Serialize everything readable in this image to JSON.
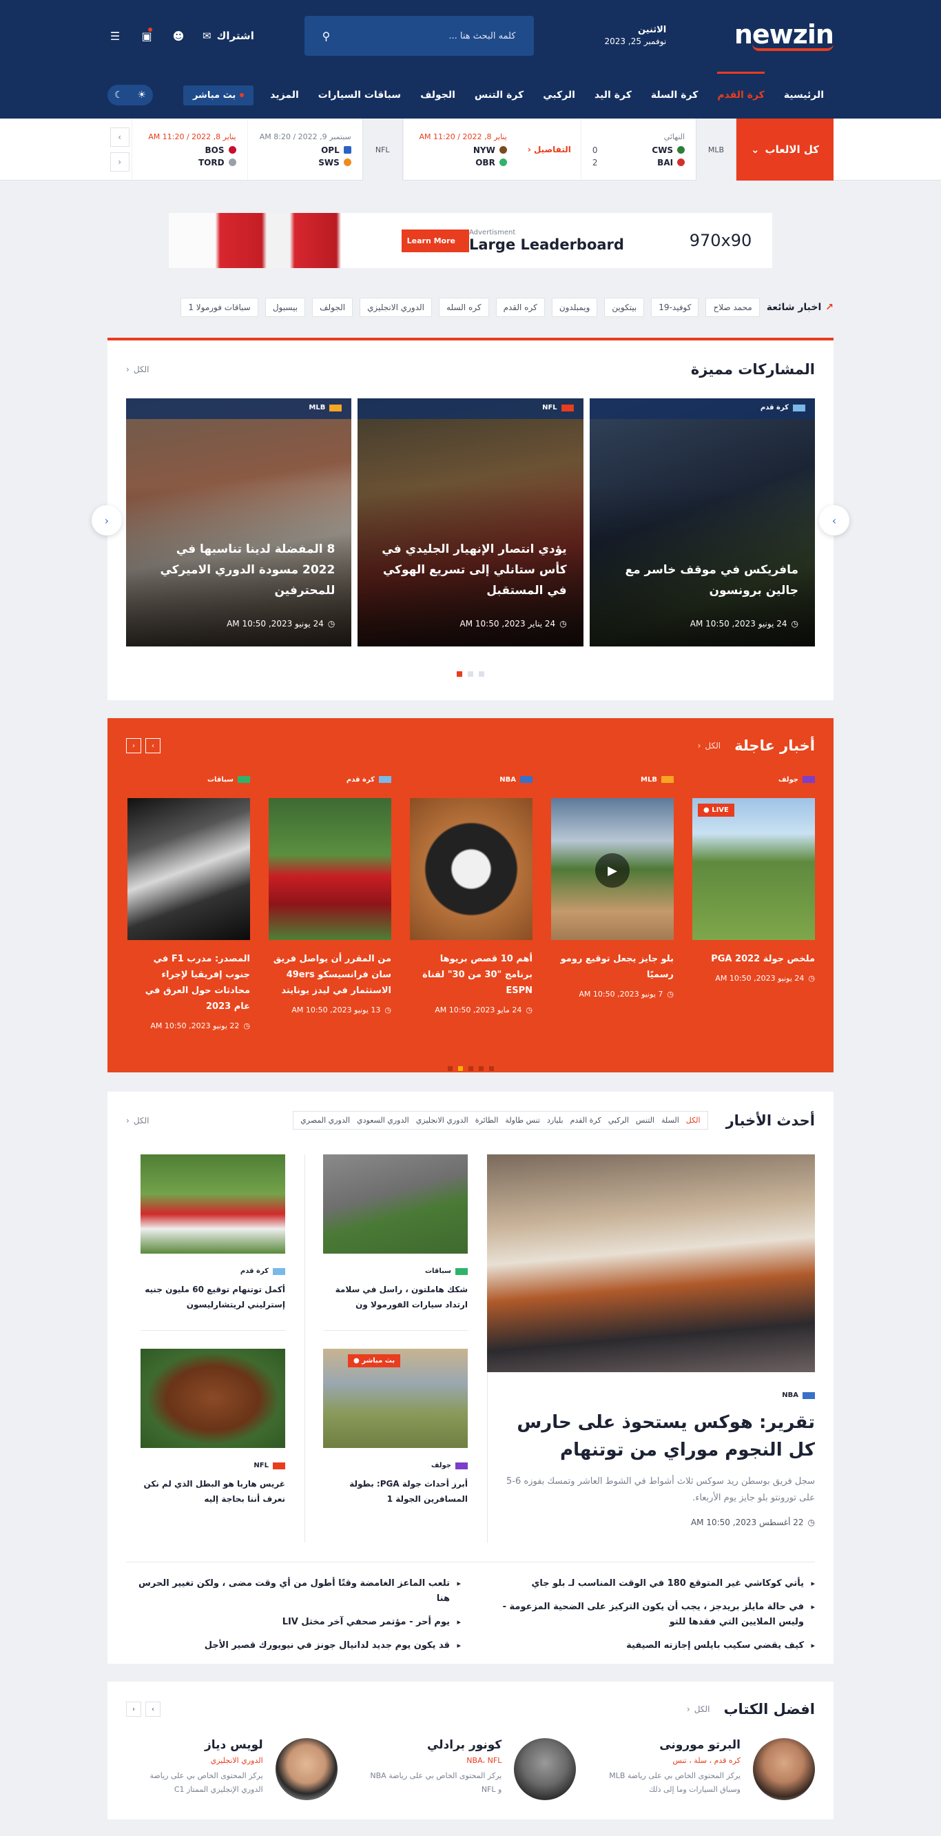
{
  "header": {
    "logo": "newzin",
    "day": "الاثنين",
    "date": "نوفمبر 25, 2023",
    "search_placeholder": "كلمه البحث هنا ...",
    "subscribe": "اشتراك"
  },
  "nav": {
    "items": [
      "الرئيسية",
      "كرة القدم",
      "كرة السلة",
      "كرة اليد",
      "الركبي",
      "كرة التنس",
      "الجولف",
      "سباقات السيارات",
      "المزيد"
    ],
    "live": "بث مباشر"
  },
  "scores": {
    "all_games": "كل الالعاب",
    "league_mlb": "MLB",
    "league_nfl": "NFL",
    "details": "التفاصيل",
    "g1": {
      "when": "النهائي",
      "t1": "CWS",
      "s1": "0",
      "t2": "BAI",
      "s2": "2"
    },
    "g2": {
      "when": "يناير 8, 2022 / 11:20 AM",
      "t1": "NYW",
      "t2": "OBR"
    },
    "g3": {
      "when": "سبتمبر 9, 2022 / 8:20 AM",
      "t1": "OPL",
      "t2": "SWS"
    },
    "g4": {
      "when": "يناير 8, 2022 / 11:20 AM",
      "t1": "BOS",
      "t2": "TORD"
    }
  },
  "ad": {
    "size": "970x90",
    "label": "Advertisment",
    "title": "Large Leaderboard",
    "cta": "Learn More"
  },
  "trending": {
    "title": "اخبار شائعة",
    "chips": [
      "محمد صلاح",
      "كوفيد-19",
      "بيتكوين",
      "ويمبلدون",
      "كره القدم",
      "كره السله",
      "الدوري الانجليزي",
      "الجولف",
      "بيسبول",
      "سباقات فورمولا 1"
    ]
  },
  "featured": {
    "title": "المشاركات مميزة",
    "see_all": "الكل",
    "cards": [
      {
        "tag": "كرة قدم",
        "title": "مافريكس في موقف خاسر مع جالين برونسون",
        "date": "24 يونيو 2023, 10:50 AM"
      },
      {
        "tag": "NFL",
        "title": "يؤدي انتصار الإنهيار الجليدي في كأس ستانلي إلى تسريع الهوكي في المستقبل",
        "date": "24 يناير 2023, 10:50 AM"
      },
      {
        "tag": "MLB",
        "title": "8 المفضلة لدينا تناسبها في 2022 مسودة الدوري الاميركي للمحترفين",
        "date": "24 يونيو 2023, 10:50 AM"
      }
    ]
  },
  "breaking": {
    "title": "أخبار عاجلة",
    "see_all": "الكل",
    "cards": [
      {
        "tag": "جولف",
        "title": "ملخص جولة PGA 2022",
        "date": "24 يونيو 2023, 10:50 AM",
        "live": "LIVE"
      },
      {
        "tag": "MLB",
        "title": "بلو جايز يجعل توقيع رومو رسميًا",
        "date": "7 يونيو 2023, 10:50 AM"
      },
      {
        "tag": "NBA",
        "title": "أهم 10 قصص بريوها برنامج \"30 من 30\" لقناة ESPN",
        "date": "24 مايو 2023, 10:50 AM"
      },
      {
        "tag": "كرة قدم",
        "title": "من المقرر أن يواصل فريق سان فرانسيسكو 49ers الاستثمار في ليدز يونايتد",
        "date": "13 يونيو 2023, 10:50 AM"
      },
      {
        "tag": "سباقات",
        "title": "المصدر: مدرب F1 في جنوب إفريقيا لإجراء محادثات حول العرق في عام 2023",
        "date": "22 يونيو 2023, 10:50 AM"
      }
    ]
  },
  "latest": {
    "title": "أحدث الأخبار",
    "see_all": "الكل",
    "filters": [
      "الكل",
      "السلة",
      "التنس",
      "الركبي",
      "كرة القدم",
      "بليارد",
      "تنس طاولة",
      "الطائرة",
      "الدوري الانجليزي",
      "الدوري السعودي",
      "الدوري المصري"
    ],
    "lead": {
      "tag": "NBA",
      "title": "تقرير: هوكس يستحوذ على حارس كل النجوم موراي من توتنهام",
      "text": "سجل فريق بوسطن ريد سوكس ثلاث أشواط في الشوط العاشر وتمسك بفوزه 6-5 على تورونتو بلو جايز يوم الأربعاء.",
      "date": "22 أغسطس 2023, 10:50 AM"
    },
    "minis": [
      {
        "tag": "سباقات",
        "title": "شكك هاملتون ، راسل في سلامة ارتداد سيارات الفورمولا ون"
      },
      {
        "tag": "جولف",
        "title": "أبرز أحداث جولة PGA: بطولة المسافرين الجولة 1",
        "badge": "بث مباشر"
      },
      {
        "tag": "كرة قدم",
        "title": "أكمل توتنهام توقيع 60 مليون جنيه إسترليني لريتشارليسون"
      },
      {
        "tag": "NFL",
        "title": "غريس هاربا هو البطل الذي لم نكن نعرف أننا بحاجة إليه"
      }
    ],
    "headlines_right": [
      "يأتي كوكاشي غير المتوقع 180 في الوقت المناسب لـ بلو جاي",
      "في حالة مايلز بريدجز ، يجب أن يكون التركيز على الضحية المزعومة - وليس الملايين التي فقدها للتو",
      "كيف يقضي سكيب بايلس إجازته الصيفية"
    ],
    "headlines_left": [
      "تلعب الماعز الغامضة وقتًا أطول من أي وقت مضى ، ولكن تغيير الحرس هنا",
      "يوم أحر - مؤتمر صحفي آخر مختل LIV",
      "قد يكون يوم جديد لدانيال جونز في نيويورك قصير الأجل"
    ]
  },
  "writers": {
    "title": "افضل الكتاب",
    "see_all": "الكل",
    "list": [
      {
        "name": "البرتو مورونى",
        "cats": "كره قدم ، سلة ، تنس",
        "bio": "يركز المحتوى الخاص بي على رياضة MLB وسباق السيارات وما إلى ذلك"
      },
      {
        "name": "كونور برادلي",
        "cats": "NBA، NFL",
        "bio": "يركز المحتوى الخاص بي على رياضة NBA و NFL"
      },
      {
        "name": "لويس دياز",
        "cats": "الدوري الانجليزي",
        "bio": "يركز المحتوى الخاص بي على رياضة الدوري الإنجليزي الممتاز C1"
      }
    ]
  },
  "colors": {
    "navy": "#15305f",
    "accent": "#e83d1e",
    "blue": "#1f4b8b"
  }
}
